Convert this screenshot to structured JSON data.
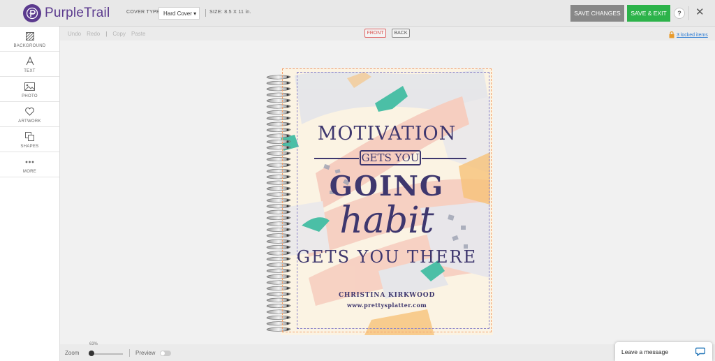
{
  "app": {
    "name": "PurpleTrail"
  },
  "header": {
    "cover_type_label": "COVER TYPE:",
    "cover_type_value": "Hard Cover ▾",
    "size_label": "SIZE: 8.5 X 11 in.",
    "save_changes": "SAVE CHANGES",
    "save_exit": "SAVE & EXIT",
    "help": "?",
    "close": "✕"
  },
  "sidebar": {
    "items": [
      {
        "label": "BACKGROUND",
        "icon": "background-icon"
      },
      {
        "label": "TEXT",
        "icon": "text-icon"
      },
      {
        "label": "PHOTO",
        "icon": "photo-icon"
      },
      {
        "label": "ARTWORK",
        "icon": "heart-icon"
      },
      {
        "label": "SHAPES",
        "icon": "shapes-icon"
      },
      {
        "label": "MORE",
        "icon": "more-icon"
      }
    ]
  },
  "toolbar": {
    "undo": "Undo",
    "redo": "Redo",
    "divider": "|",
    "copy": "Copy",
    "paste": "Paste",
    "front": "FRONT",
    "back": "BACK",
    "locked_items": "3 locked items"
  },
  "cover": {
    "line1": "MOTIVATION",
    "line2": "GETS YOU",
    "line3": "GOING",
    "line4": "habit",
    "line5": "GETS YOU THERE",
    "author": "CHRISTINA KIRKWOOD",
    "url": "www.prettysplatter.com"
  },
  "footer": {
    "zoom_percent": "63%",
    "zoom_label": "Zoom",
    "preview_label": "Preview",
    "chat_label": "Leave a message"
  },
  "colors": {
    "brand_purple": "#5b3a8e",
    "save_green": "#2cb34a",
    "save_changes_gray": "#888888",
    "text_navy": "#3e376e",
    "cover_bg": "#fbf3e3"
  }
}
